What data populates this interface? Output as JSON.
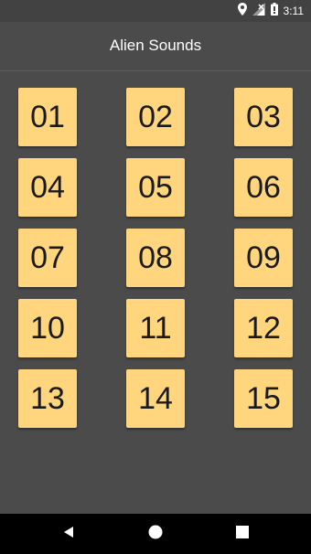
{
  "status_bar": {
    "time": "3:11",
    "icons": [
      "location-icon",
      "no-signal-icon",
      "battery-icon"
    ]
  },
  "app_bar": {
    "title": "Alien Sounds"
  },
  "sounds": [
    "01",
    "02",
    "03",
    "04",
    "05",
    "06",
    "07",
    "08",
    "09",
    "10",
    "11",
    "12",
    "13",
    "14",
    "15"
  ],
  "colors": {
    "background": "#4b4b4b",
    "button": "#ffd57d",
    "button_text": "#1a1a1a",
    "nav_bar": "#000000"
  },
  "nav_bar": {
    "icons": [
      "back-icon",
      "home-icon",
      "recents-icon"
    ]
  }
}
